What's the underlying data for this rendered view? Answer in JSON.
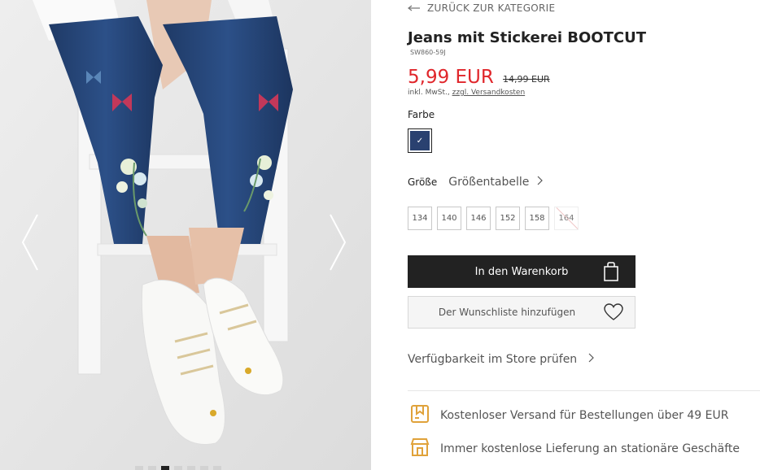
{
  "gallery": {
    "dot_count": 7,
    "active_dot": 2
  },
  "product": {
    "back_label": "ZURÜCK ZUR KATEGORIE",
    "title": "Jeans mit Stickerei BOOTCUT",
    "sku": "SW860-59J",
    "price": "5,99 EUR",
    "old_price": "14,99 EUR",
    "vat_text": "inkl. MwSt., ",
    "shipping_link": "zzgl. Versandkosten",
    "color_label": "Farbe",
    "swatch_color": "#2a4170",
    "size_label": "Größe",
    "size_chart_label": "Größentabelle",
    "sizes": [
      {
        "label": "134",
        "available": true
      },
      {
        "label": "140",
        "available": true
      },
      {
        "label": "146",
        "available": true
      },
      {
        "label": "152",
        "available": true
      },
      {
        "label": "158",
        "available": true
      },
      {
        "label": "164",
        "available": false
      }
    ],
    "cart_button": "In den Warenkorb",
    "wishlist_button": "Der Wunschliste hinzufügen",
    "store_check": "Verfügbarkeit im Store prüfen"
  },
  "benefits": [
    {
      "icon": "package-icon",
      "text": "Kostenloser Versand für Bestellungen über 49 EUR"
    },
    {
      "icon": "store-icon",
      "text": "Immer kostenlose Lieferung an stationäre Geschäfte"
    }
  ],
  "colors": {
    "price_red": "#e0262b",
    "benefit_icon": "#e0a23a",
    "button_dark": "#222222"
  }
}
